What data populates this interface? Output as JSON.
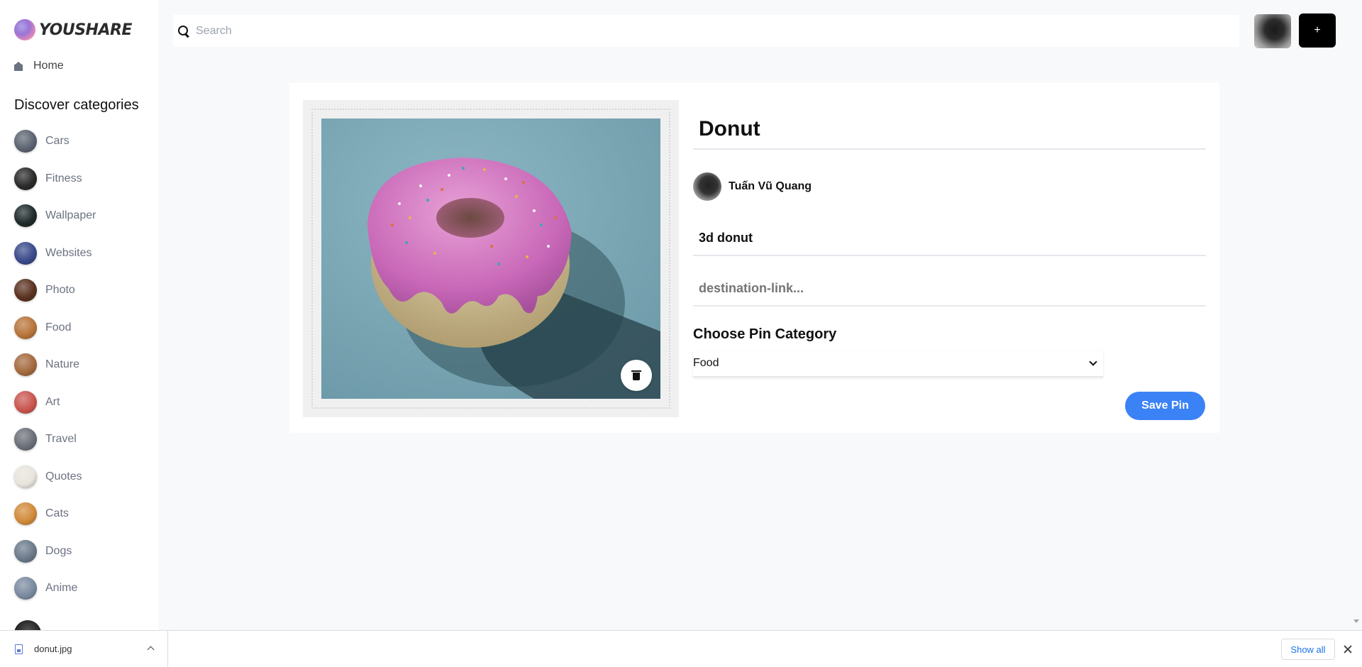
{
  "sidebar": {
    "logo_text": "YOUSHARE",
    "home_label": "Home",
    "discover_heading": "Discover categories",
    "categories": [
      {
        "label": "Cars",
        "color": "#5b6470"
      },
      {
        "label": "Fitness",
        "color": "#2a2a2a"
      },
      {
        "label": "Wallpaper",
        "color": "#1f2a2a"
      },
      {
        "label": "Websites",
        "color": "#3a4a8a"
      },
      {
        "label": "Photo",
        "color": "#5a3220"
      },
      {
        "label": "Food",
        "color": "#b8743a"
      },
      {
        "label": "Nature",
        "color": "#a46a3e"
      },
      {
        "label": "Art",
        "color": "#c9554f"
      },
      {
        "label": "Travel",
        "color": "#6b6f78"
      },
      {
        "label": "Quotes",
        "color": "#e8e4dc"
      },
      {
        "label": "Cats",
        "color": "#d18a3a"
      },
      {
        "label": "Dogs",
        "color": "#6a7a8a"
      },
      {
        "label": "Anime",
        "color": "#7a8aa0"
      }
    ]
  },
  "header": {
    "search_placeholder": "Search",
    "add_label": "+"
  },
  "pin": {
    "title": "Donut",
    "author_name": "Tuấn Vũ Quang",
    "about": "3d donut",
    "destination_placeholder": "destination-link...",
    "category_heading": "Choose Pin Category",
    "category_selected": "Food",
    "save_label": "Save Pin"
  },
  "downloads": {
    "file_name": "donut.jpg",
    "show_all_label": "Show all"
  },
  "colors": {
    "accent": "#3b82f6",
    "image_bg": "#7da7b5"
  }
}
